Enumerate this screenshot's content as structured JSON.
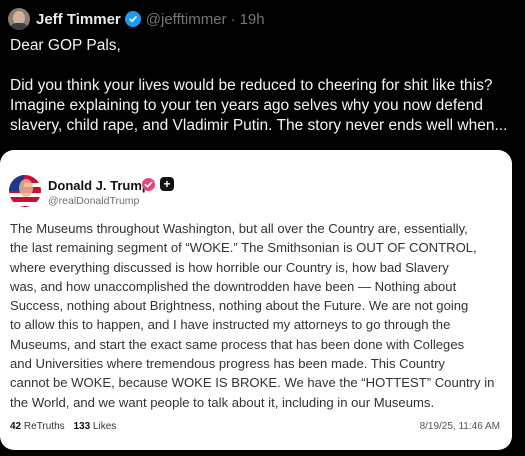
{
  "tweet": {
    "author_name": "Jeff Timmer",
    "handle": "@jefftimmer",
    "separator": "·",
    "age": "19h",
    "text_lines": [
      "Dear GOP Pals,",
      "",
      "Did you think your lives would be reduced to cheering for shit like this?",
      "Imagine explaining to your ten years ago selves why you now defend",
      "slavery, child rape, and Vladimir Putin. The story never ends well when..."
    ]
  },
  "quoted_post": {
    "author_name": "Donald J. Trump",
    "handle": "@realDonaldTrump",
    "plus_icon": "+",
    "text_lines": [
      "The Museums throughout Washington, but all over the Country are, essentially,",
      "the last remaining segment of “WOKE.” The Smithsonian is OUT OF CONTROL,",
      "where everything discussed is how horrible our Country is, how bad Slavery",
      "was, and how unaccomplished the downtrodden have been — Nothing about",
      "Success, nothing about Brightness, nothing about the Future. We are not going",
      "to allow this to happen, and I have instructed my attorneys to go through the",
      "Museums, and start the exact same process that has been done with Colleges",
      "and Universities where tremendous progress has been made. This Country",
      "cannot be WOKE, because WOKE IS BROKE. We have the “HOTTEST” Country in",
      "the World, and we want people to talk about it, including in our Museums."
    ],
    "retruths_count": "42",
    "retruths_label": "ReTruths",
    "likes_count": "133",
    "likes_label": "Likes",
    "timestamp": "8/19/25, 11:46 AM"
  },
  "colors": {
    "background": "#000000",
    "verified_blue": "#1d9bf0",
    "verified_pink": "#e3457f",
    "muted": "#71767b"
  },
  "icons": [
    "verified-badge-icon",
    "verified-badge-pink-icon",
    "plus-icon"
  ]
}
